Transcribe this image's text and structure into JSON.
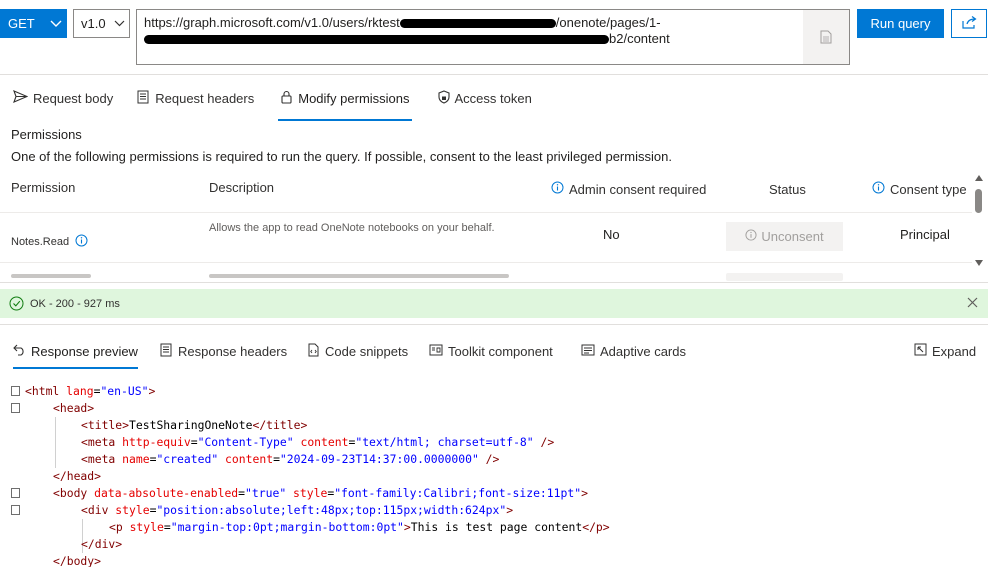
{
  "query": {
    "method": "GET",
    "version": "v1.0",
    "url_line1_start": "https://graph.microsoft.com/v1.0/users/rktest",
    "url_line1_end": "/onenote/pages/1-",
    "url_line2_start": "",
    "url_line2_end": "b2/content",
    "run_label": "Run query"
  },
  "request_tabs": [
    "Request body",
    "Request headers",
    "Modify permissions",
    "Access token"
  ],
  "permissions": {
    "title": "Permissions",
    "subtitle": "One of the following permissions is required to run the query. If possible, consent to the least privileged permission.",
    "columns": [
      "Permission",
      "Description",
      "Admin consent required",
      "Status",
      "Consent type"
    ],
    "rows": [
      {
        "permission": "Notes.Read",
        "description": "Allows the app to read OneNote notebooks on your behalf.",
        "admin_consent": "No",
        "status": "Unconsent",
        "consent_type": "Principal"
      }
    ]
  },
  "status_bar": {
    "text": "OK - 200 - 927 ms",
    "color": "#dff6dd"
  },
  "response_tabs": [
    "Response preview",
    "Response headers",
    "Code snippets",
    "Toolkit component",
    "Adaptive cards"
  ],
  "expand_label": "Expand",
  "code": {
    "l1": {
      "tag": "html",
      "attr": "lang",
      "val": "\"en-US\""
    },
    "l2": {
      "tag": "head"
    },
    "l3": {
      "tag": "title",
      "text": "TestSharingOneNote"
    },
    "l4": {
      "a1": "http-equiv",
      "v1": "\"Content-Type\"",
      "a2": "content",
      "v2": "\"text/html; charset=utf-8\""
    },
    "l5": {
      "a1": "name",
      "v1": "\"created\"",
      "a2": "content",
      "v2": "\"2024-09-23T14:37:00.0000000\""
    },
    "l7": {
      "a1": "data-absolute-enabled",
      "v1": "\"true\"",
      "a2": "style",
      "v2": "\"font-family:Calibri;font-size:11pt\""
    },
    "l8": {
      "a1": "style",
      "v1": "\"position:absolute;left:48px;top:115px;width:624px\""
    },
    "l9": {
      "a1": "style",
      "v1": "\"margin-top:0pt;margin-bottom:0pt\"",
      "text": "This is test page content"
    }
  },
  "colors": {
    "accent": "#0078d4",
    "success_bg": "#dff6dd"
  }
}
